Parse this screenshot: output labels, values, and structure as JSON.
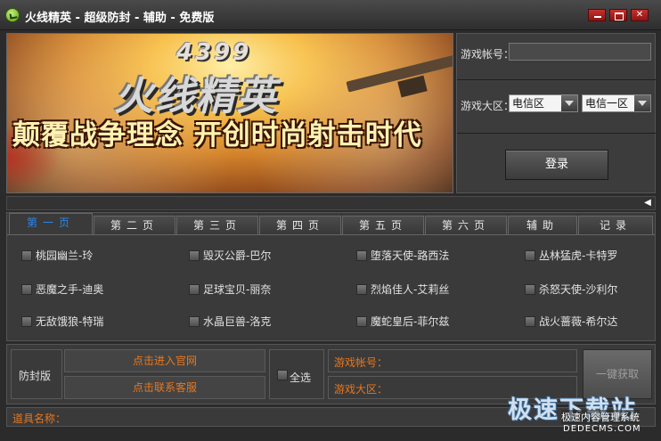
{
  "window": {
    "title": "火线精英 - 超级防封 - 辅助 - 免费版"
  },
  "banner": {
    "logo_number": "4399",
    "logo_title": "火线精英",
    "slogan": "颠覆战争理念 开创时尚射击时代"
  },
  "login": {
    "account_label": "游戏帐号：",
    "account_value": "",
    "region_label": "游戏大区：",
    "region_select_1": "电信区",
    "region_select_2": "电信一区",
    "login_button": "登录"
  },
  "tabs": [
    {
      "label": "第一页",
      "active": true
    },
    {
      "label": "第二页",
      "active": false
    },
    {
      "label": "第三页",
      "active": false
    },
    {
      "label": "第四页",
      "active": false
    },
    {
      "label": "第五页",
      "active": false
    },
    {
      "label": "第六页",
      "active": false
    },
    {
      "label": "辅助",
      "active": false
    },
    {
      "label": "记录",
      "active": false
    }
  ],
  "heroes": [
    "桃园幽兰-玲",
    "毁灭公爵-巴尔",
    "堕落天使-路西法",
    "丛林猛虎-卡特罗",
    "恶魔之手-迪奥",
    "足球宝贝-丽奈",
    "烈焰佳人-艾莉丝",
    "杀怒天使-沙利尔",
    "无敌饿狼-特瑞",
    "水晶巨兽-洛克",
    "魔蛇皇后-菲尔兹",
    "战火蔷薇-希尔达"
  ],
  "bottom": {
    "anti_ban_label": "防封版",
    "official_site_button": "点击进入官网",
    "contact_service_button": "点击联系客服",
    "select_all_label": "全选",
    "account_label": "游戏帐号：",
    "region_label": "游戏大区：",
    "fetch_button": "一键获取"
  },
  "status": {
    "item_name_label": "道具名称："
  },
  "watermark": {
    "main": "极速下载站",
    "sub": "极速内容管理系统",
    "url": "DEDECMS.COM"
  },
  "colors": {
    "active_tab": "#2f86e6",
    "orange_text": "#e7771f",
    "window_bg": "#2b2b2b",
    "close_red": "#c8302c"
  }
}
